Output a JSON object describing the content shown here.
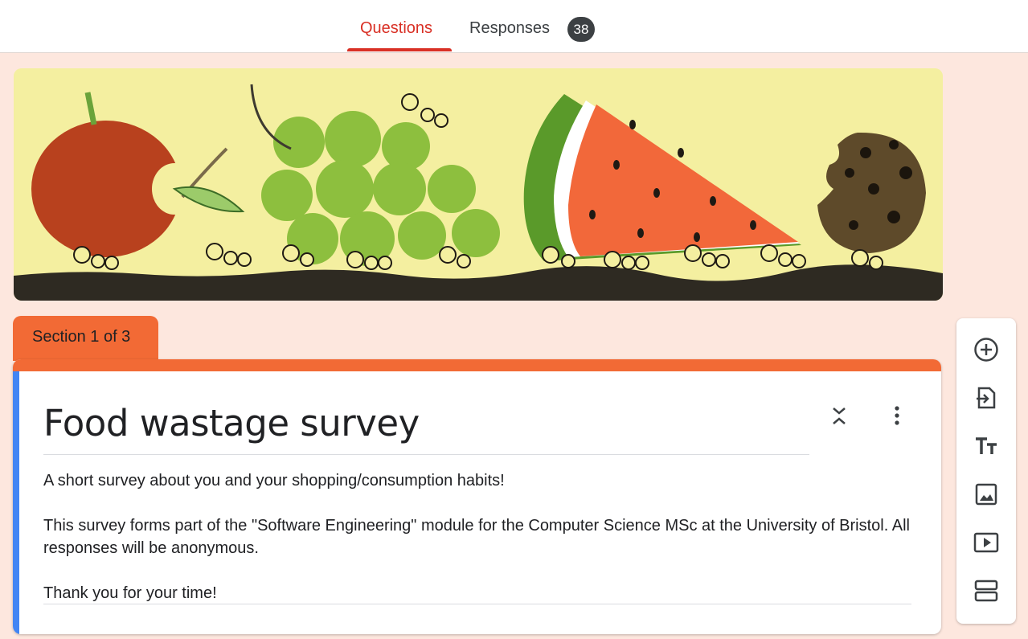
{
  "tabs": {
    "questions_label": "Questions",
    "responses_label": "Responses",
    "responses_count": "38"
  },
  "section": {
    "label": "Section 1 of 3"
  },
  "form": {
    "title": "Food wastage survey",
    "description_lines": [
      "A short survey about you and your shopping/consumption habits!",
      "This survey forms part of the \"Software Engineering\" module for the Computer Science MSc at the University of Bristol. All responses will be anonymous.",
      "Thank you for your time!"
    ]
  },
  "toolbar": {
    "items": [
      {
        "icon": "add-circle-icon"
      },
      {
        "icon": "import-questions-icon"
      },
      {
        "icon": "title-text-icon"
      },
      {
        "icon": "image-icon"
      },
      {
        "icon": "video-icon"
      },
      {
        "icon": "section-icon"
      }
    ]
  },
  "colors": {
    "accent": "#d93025",
    "theme": "#f26a35",
    "background": "#fde7de",
    "focus_bar": "#4285f4"
  }
}
